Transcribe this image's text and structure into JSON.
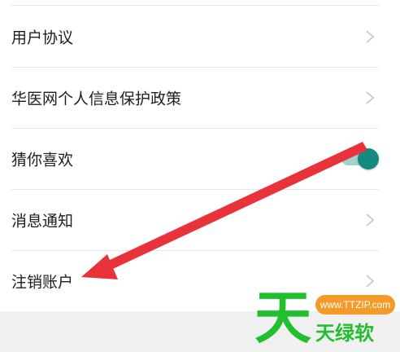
{
  "settings": {
    "items": [
      {
        "label": "用户协议",
        "control": "chevron-right-icon"
      },
      {
        "label": "华医网个人信息保护政策",
        "control": "chevron-right-icon"
      },
      {
        "label": "猜你喜欢",
        "control": "toggle",
        "enabled": true
      },
      {
        "label": "消息通知",
        "control": "chevron-right-icon"
      },
      {
        "label": "注销账户",
        "control": "chevron-right-icon"
      }
    ]
  },
  "colors": {
    "toggle_on": "#138b7e",
    "toggle_track": "#9fd4cd",
    "annotation_arrow": "#e8333b",
    "watermark_green": "#1fbf2e",
    "watermark_orange": "#f39a28"
  },
  "watermark": {
    "char": "天",
    "url": "www.TTZIP.com",
    "name": "天绿软"
  }
}
